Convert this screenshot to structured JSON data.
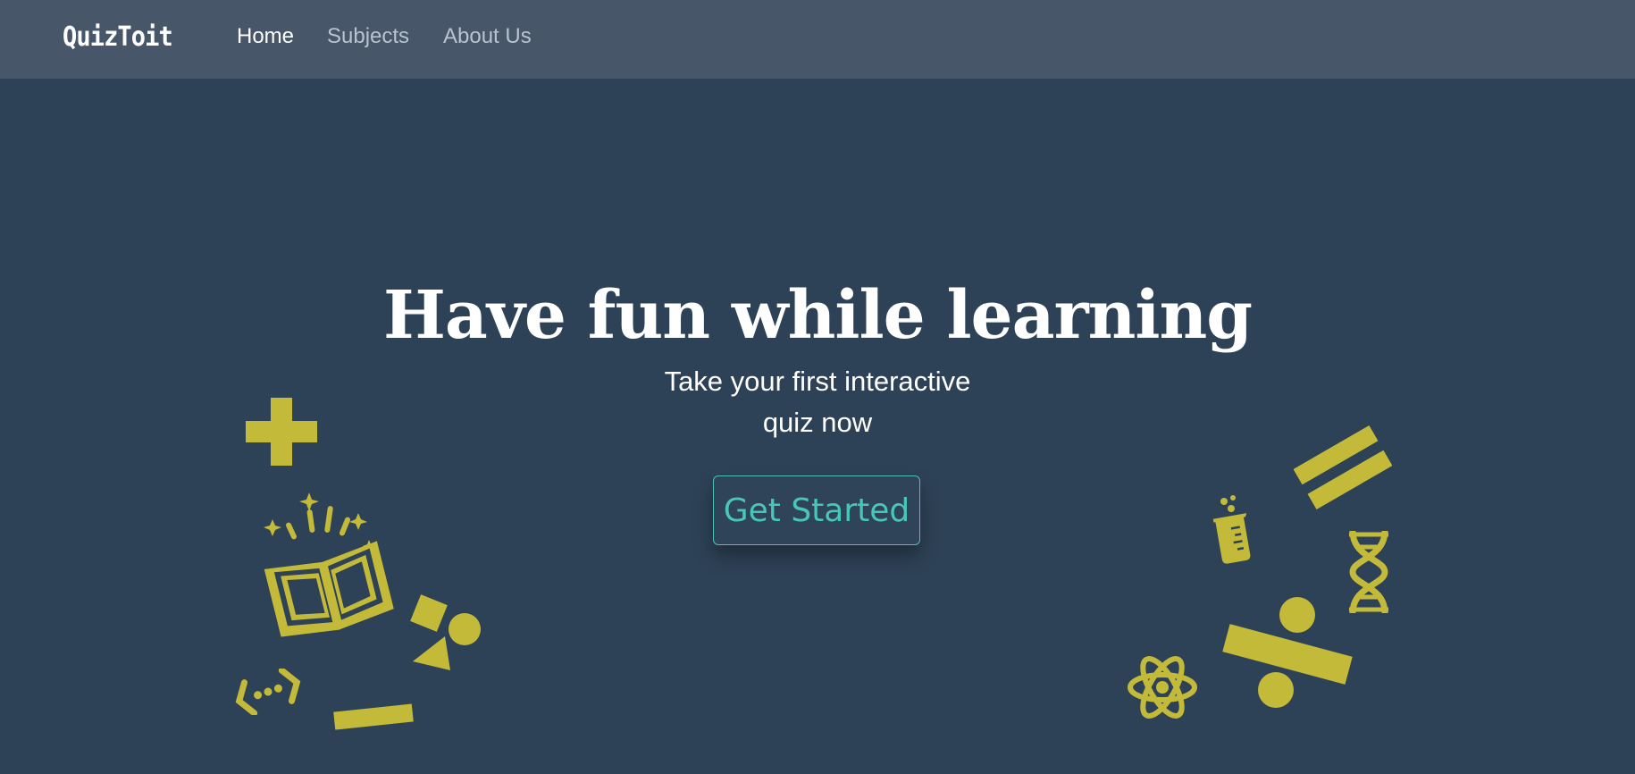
{
  "nav": {
    "brand": "QuizToit",
    "links": [
      "Home",
      "Subjects",
      "About Us"
    ],
    "active": "Home"
  },
  "hero": {
    "title": "Have fun while learning",
    "subtitle_line1": "Take your first interactive",
    "subtitle_line2": "quiz now",
    "cta_label": "Get Started"
  },
  "colors": {
    "background": "#2e4257",
    "navbar": "#475669",
    "accent": "#48c6b8",
    "decoration": "#c4ba3a"
  },
  "icons": [
    "plus-icon",
    "open-book-icon",
    "shapes-icon",
    "code-brackets-icon",
    "minus-icon",
    "equals-icon",
    "beaker-icon",
    "dna-icon",
    "atom-icon",
    "divide-icon"
  ]
}
